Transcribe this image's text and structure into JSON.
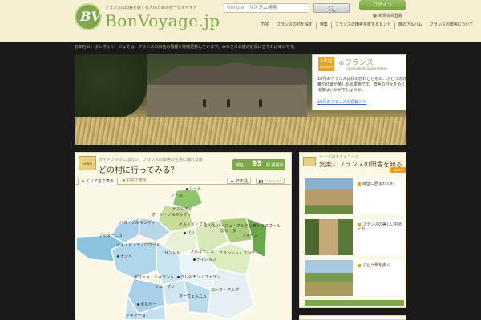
{
  "header": {
    "tagline": "フランスの田舎を旅する人のためのポータルサイト",
    "logo_text": "BonVoyage.jp",
    "logo_badge": "BV",
    "search": {
      "engine_label": "Google",
      "placeholder": "カスタム検索"
    },
    "login_label": "ログイン",
    "register_label": "新規会員登録",
    "nav": [
      "TOP",
      "フランスの村を探す",
      "特集",
      "フランスの田舎を旅するヒント",
      "旅のアルバム",
      "フランスの田舎について"
    ]
  },
  "announcement": "お知らせ：ボンヴォヤージュでは、フランスの田舎の情報を随時更新しています。みなさまの旅のお役に立てれば幸いです。",
  "hero": {
    "date_num": "10月",
    "date_month": "Octobre",
    "title_prefix": "の",
    "title": "フランス",
    "subtitle": "Informations Saisonnières",
    "body": "10月のフランスは秋の訪れとともに、ぶどうの収穫や紅葉が楽しめる季節です。田舎の村々をめぐる旅はいかがでしょうか。",
    "more_link": "10月のフランスの情報＞＞"
  },
  "village_panel": {
    "intro": "ガイドブックにはない、フランスの田舎の生活に触れる旅",
    "heading": "どの村に行ってみる？",
    "guide_icon": "GUIDE",
    "count_label_pre": "現在",
    "count": "93",
    "count_label_post": "村 掲載中",
    "tab_area": "エリア名で表示",
    "tab_village": "村名で表示",
    "lang_ja": "日本語",
    "lang_fr": "Français",
    "regions": [
      "リール",
      "ノール",
      "ピカルディ",
      "オート・ノルマンディ",
      "バス・ノルマンディ",
      "イル・ド・フランス",
      "パリ",
      "シャンパーニュ・アルデンヌ",
      "ロレーヌ",
      "アルザス",
      "ストラスブール",
      "ブルターニュ",
      "サントル",
      "ペイ・ド・ラ・ロワール",
      "ナント",
      "ブルゴーニュ",
      "ディジョン",
      "フランシュ・コンテ",
      "ポワトゥ・シャラント",
      "リムーザン",
      "クレルモン・フェラン",
      "オーヴェルニュ",
      "ローヌ・アルプ",
      "ボルドー",
      "アキテーヌ"
    ]
  },
  "side": {
    "kicker": "テーマ別モデルコース",
    "title": "気楽にフランスの田舎を知る",
    "ribbon": "new",
    "items": [
      {
        "caption": "城壁に囲まれた村"
      },
      {
        "caption": "フランスの美しい村めぐり"
      },
      {
        "caption": "ぶどう畑を歩く"
      }
    ]
  },
  "colors": {
    "accent_green": "#7fa84a",
    "accent_orange": "#e8a020",
    "header_bg": "#f6efd2"
  }
}
